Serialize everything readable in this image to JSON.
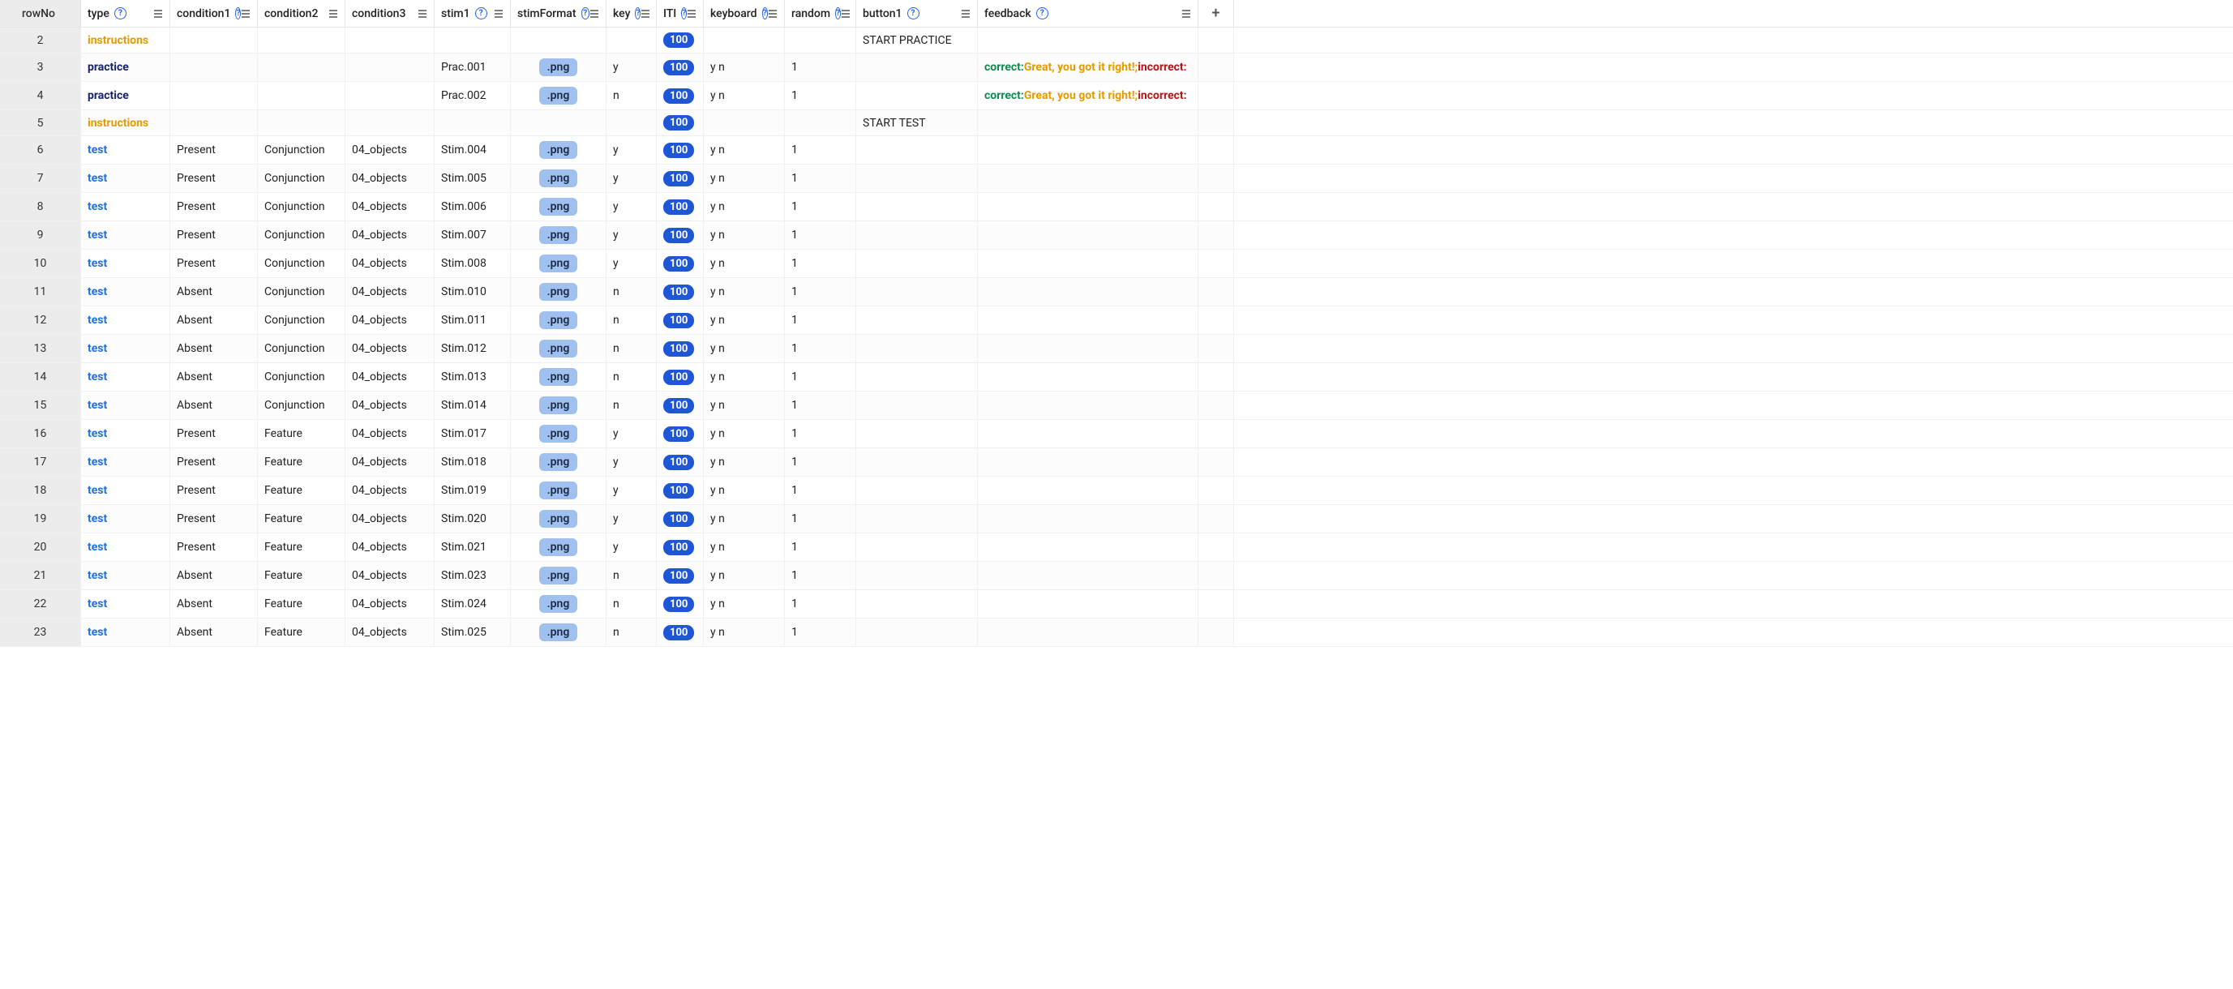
{
  "columns": {
    "rowNo": "rowNo",
    "type": "type",
    "condition1": "condition1",
    "condition2": "condition2",
    "condition3": "condition3",
    "stim1": "stim1",
    "stimFormat": "stimFormat",
    "key": "key",
    "ITI": "ITI",
    "keyboard": "keyboard",
    "random": "random",
    "button1": "button1",
    "feedback": "feedback",
    "add": "+"
  },
  "helpGlyph": "?",
  "rows": [
    {
      "rowNo": "2",
      "type": "instructions",
      "condition1": "",
      "condition2": "",
      "condition3": "",
      "stim1": "",
      "stimFormat": "",
      "key": "",
      "ITI": "100",
      "keyboard": "",
      "random": "",
      "button1": "START PRACTICE",
      "feedback": null
    },
    {
      "rowNo": "3",
      "type": "practice",
      "condition1": "",
      "condition2": "",
      "condition3": "",
      "stim1": "Prac.001",
      "stimFormat": ".png",
      "key": "y",
      "ITI": "100",
      "keyboard": "y n",
      "random": "1",
      "button1": "",
      "feedback": {
        "correctLabel": "correct:",
        "correctMsg": "Great, you got it right!;",
        "incorrectLabel": " incorrect:"
      }
    },
    {
      "rowNo": "4",
      "type": "practice",
      "condition1": "",
      "condition2": "",
      "condition3": "",
      "stim1": "Prac.002",
      "stimFormat": ".png",
      "key": "n",
      "ITI": "100",
      "keyboard": "y n",
      "random": "1",
      "button1": "",
      "feedback": {
        "correctLabel": "correct:",
        "correctMsg": "Great, you got it right!;",
        "incorrectLabel": " incorrect:"
      }
    },
    {
      "rowNo": "5",
      "type": "instructions",
      "condition1": "",
      "condition2": "",
      "condition3": "",
      "stim1": "",
      "stimFormat": "",
      "key": "",
      "ITI": "100",
      "keyboard": "",
      "random": "",
      "button1": "START TEST",
      "feedback": null
    },
    {
      "rowNo": "6",
      "type": "test",
      "condition1": "Present",
      "condition2": "Conjunction",
      "condition3": "04_objects",
      "stim1": "Stim.004",
      "stimFormat": ".png",
      "key": "y",
      "ITI": "100",
      "keyboard": "y n",
      "random": "1",
      "button1": "",
      "feedback": null
    },
    {
      "rowNo": "7",
      "type": "test",
      "condition1": "Present",
      "condition2": "Conjunction",
      "condition3": "04_objects",
      "stim1": "Stim.005",
      "stimFormat": ".png",
      "key": "y",
      "ITI": "100",
      "keyboard": "y n",
      "random": "1",
      "button1": "",
      "feedback": null
    },
    {
      "rowNo": "8",
      "type": "test",
      "condition1": "Present",
      "condition2": "Conjunction",
      "condition3": "04_objects",
      "stim1": "Stim.006",
      "stimFormat": ".png",
      "key": "y",
      "ITI": "100",
      "keyboard": "y n",
      "random": "1",
      "button1": "",
      "feedback": null
    },
    {
      "rowNo": "9",
      "type": "test",
      "condition1": "Present",
      "condition2": "Conjunction",
      "condition3": "04_objects",
      "stim1": "Stim.007",
      "stimFormat": ".png",
      "key": "y",
      "ITI": "100",
      "keyboard": "y n",
      "random": "1",
      "button1": "",
      "feedback": null
    },
    {
      "rowNo": "10",
      "type": "test",
      "condition1": "Present",
      "condition2": "Conjunction",
      "condition3": "04_objects",
      "stim1": "Stim.008",
      "stimFormat": ".png",
      "key": "y",
      "ITI": "100",
      "keyboard": "y n",
      "random": "1",
      "button1": "",
      "feedback": null
    },
    {
      "rowNo": "11",
      "type": "test",
      "condition1": "Absent",
      "condition2": "Conjunction",
      "condition3": "04_objects",
      "stim1": "Stim.010",
      "stimFormat": ".png",
      "key": "n",
      "ITI": "100",
      "keyboard": "y n",
      "random": "1",
      "button1": "",
      "feedback": null
    },
    {
      "rowNo": "12",
      "type": "test",
      "condition1": "Absent",
      "condition2": "Conjunction",
      "condition3": "04_objects",
      "stim1": "Stim.011",
      "stimFormat": ".png",
      "key": "n",
      "ITI": "100",
      "keyboard": "y n",
      "random": "1",
      "button1": "",
      "feedback": null
    },
    {
      "rowNo": "13",
      "type": "test",
      "condition1": "Absent",
      "condition2": "Conjunction",
      "condition3": "04_objects",
      "stim1": "Stim.012",
      "stimFormat": ".png",
      "key": "n",
      "ITI": "100",
      "keyboard": "y n",
      "random": "1",
      "button1": "",
      "feedback": null
    },
    {
      "rowNo": "14",
      "type": "test",
      "condition1": "Absent",
      "condition2": "Conjunction",
      "condition3": "04_objects",
      "stim1": "Stim.013",
      "stimFormat": ".png",
      "key": "n",
      "ITI": "100",
      "keyboard": "y n",
      "random": "1",
      "button1": "",
      "feedback": null
    },
    {
      "rowNo": "15",
      "type": "test",
      "condition1": "Absent",
      "condition2": "Conjunction",
      "condition3": "04_objects",
      "stim1": "Stim.014",
      "stimFormat": ".png",
      "key": "n",
      "ITI": "100",
      "keyboard": "y n",
      "random": "1",
      "button1": "",
      "feedback": null
    },
    {
      "rowNo": "16",
      "type": "test",
      "condition1": "Present",
      "condition2": "Feature",
      "condition3": "04_objects",
      "stim1": "Stim.017",
      "stimFormat": ".png",
      "key": "y",
      "ITI": "100",
      "keyboard": "y n",
      "random": "1",
      "button1": "",
      "feedback": null
    },
    {
      "rowNo": "17",
      "type": "test",
      "condition1": "Present",
      "condition2": "Feature",
      "condition3": "04_objects",
      "stim1": "Stim.018",
      "stimFormat": ".png",
      "key": "y",
      "ITI": "100",
      "keyboard": "y n",
      "random": "1",
      "button1": "",
      "feedback": null
    },
    {
      "rowNo": "18",
      "type": "test",
      "condition1": "Present",
      "condition2": "Feature",
      "condition3": "04_objects",
      "stim1": "Stim.019",
      "stimFormat": ".png",
      "key": "y",
      "ITI": "100",
      "keyboard": "y n",
      "random": "1",
      "button1": "",
      "feedback": null
    },
    {
      "rowNo": "19",
      "type": "test",
      "condition1": "Present",
      "condition2": "Feature",
      "condition3": "04_objects",
      "stim1": "Stim.020",
      "stimFormat": ".png",
      "key": "y",
      "ITI": "100",
      "keyboard": "y n",
      "random": "1",
      "button1": "",
      "feedback": null
    },
    {
      "rowNo": "20",
      "type": "test",
      "condition1": "Present",
      "condition2": "Feature",
      "condition3": "04_objects",
      "stim1": "Stim.021",
      "stimFormat": ".png",
      "key": "y",
      "ITI": "100",
      "keyboard": "y n",
      "random": "1",
      "button1": "",
      "feedback": null
    },
    {
      "rowNo": "21",
      "type": "test",
      "condition1": "Absent",
      "condition2": "Feature",
      "condition3": "04_objects",
      "stim1": "Stim.023",
      "stimFormat": ".png",
      "key": "n",
      "ITI": "100",
      "keyboard": "y n",
      "random": "1",
      "button1": "",
      "feedback": null
    },
    {
      "rowNo": "22",
      "type": "test",
      "condition1": "Absent",
      "condition2": "Feature",
      "condition3": "04_objects",
      "stim1": "Stim.024",
      "stimFormat": ".png",
      "key": "n",
      "ITI": "100",
      "keyboard": "y n",
      "random": "1",
      "button1": "",
      "feedback": null
    },
    {
      "rowNo": "23",
      "type": "test",
      "condition1": "Absent",
      "condition2": "Feature",
      "condition3": "04_objects",
      "stim1": "Stim.025",
      "stimFormat": ".png",
      "key": "n",
      "ITI": "100",
      "keyboard": "y n",
      "random": "1",
      "button1": "",
      "feedback": null
    }
  ]
}
